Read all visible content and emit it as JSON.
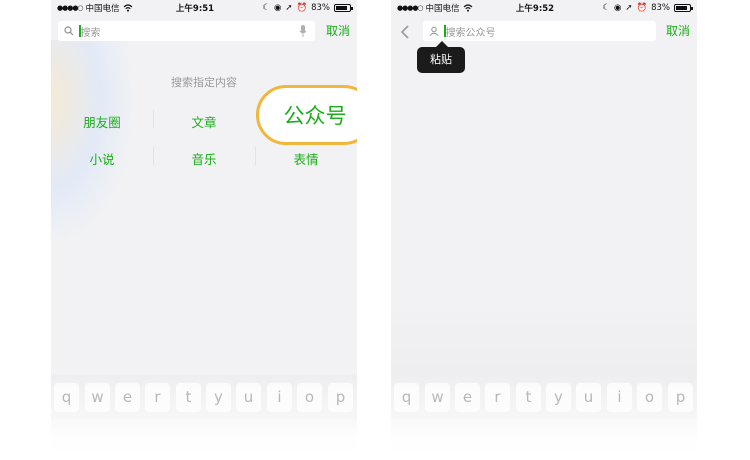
{
  "left_screen": {
    "status": {
      "carrier": "中国电信",
      "time": "上午9:51",
      "battery": "83%",
      "battery_level": 0.83
    },
    "search": {
      "placeholder": "搜索",
      "cancel_label": "取消"
    },
    "hint": "搜索指定内容",
    "categories": [
      "朋友圈",
      "文章",
      "公众号",
      "小说",
      "音乐",
      "表情"
    ],
    "highlighted_label": "公众号"
  },
  "right_screen": {
    "status": {
      "carrier": "中国电信",
      "time": "上午9:52",
      "battery": "83%",
      "battery_level": 0.83
    },
    "search": {
      "placeholder": "搜索公众号",
      "cancel_label": "取消"
    },
    "tooltip": "粘贴"
  },
  "keyboard_keys": [
    "q",
    "w",
    "e",
    "r",
    "t",
    "y",
    "u",
    "i",
    "o",
    "p"
  ],
  "colors": {
    "accent_green": "#1aad19",
    "highlight_ring": "#f0b73c"
  }
}
